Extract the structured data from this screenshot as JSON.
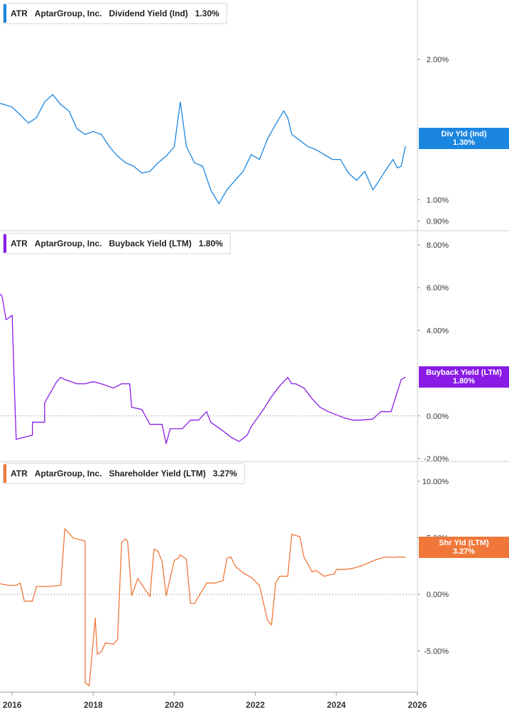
{
  "chart_data": [
    {
      "type": "line",
      "ticker": "ATR",
      "company": "AptarGroup, Inc.",
      "metric": "Dividend Yield (Ind)",
      "current": "1.30%",
      "tag_line1": "Div Yld (Ind)",
      "tag_line2": "1.30%",
      "color": "#1a86e0",
      "scale": "log",
      "ylim": [
        0.87,
        2.5
      ],
      "yticks": [
        "2.00%",
        "1.00%",
        "0.90%"
      ],
      "ytick_values": [
        2.0,
        1.0,
        0.9
      ],
      "x": [
        2015.6,
        2015.8,
        2016.0,
        2016.2,
        2016.4,
        2016.6,
        2016.8,
        2017.0,
        2017.2,
        2017.4,
        2017.6,
        2017.8,
        2018.0,
        2018.2,
        2018.4,
        2018.6,
        2018.8,
        2019.0,
        2019.2,
        2019.4,
        2019.6,
        2019.8,
        2020.0,
        2020.15,
        2020.3,
        2020.5,
        2020.7,
        2020.9,
        2021.1,
        2021.3,
        2021.5,
        2021.7,
        2021.9,
        2022.1,
        2022.3,
        2022.5,
        2022.7,
        2022.8,
        2022.9,
        2023.1,
        2023.3,
        2023.5,
        2023.7,
        2023.9,
        2024.1,
        2024.3,
        2024.5,
        2024.7,
        2024.9,
        2025.0,
        2025.2,
        2025.4,
        2025.5,
        2025.6,
        2025.7
      ],
      "y": [
        1.62,
        1.6,
        1.58,
        1.52,
        1.46,
        1.5,
        1.62,
        1.68,
        1.6,
        1.55,
        1.42,
        1.38,
        1.4,
        1.38,
        1.3,
        1.24,
        1.2,
        1.18,
        1.14,
        1.15,
        1.2,
        1.24,
        1.3,
        1.62,
        1.3,
        1.2,
        1.18,
        1.05,
        0.98,
        1.05,
        1.1,
        1.15,
        1.25,
        1.22,
        1.35,
        1.45,
        1.55,
        1.5,
        1.38,
        1.34,
        1.3,
        1.28,
        1.25,
        1.22,
        1.22,
        1.14,
        1.1,
        1.15,
        1.05,
        1.08,
        1.15,
        1.22,
        1.17,
        1.18,
        1.3
      ],
      "last_value": 1.3
    },
    {
      "type": "line",
      "ticker": "ATR",
      "company": "AptarGroup, Inc.",
      "metric": "Buyback Yield (LTM)",
      "current": "1.80%",
      "tag_line1": "Buyback Yield (LTM)",
      "tag_line2": "1.80%",
      "color": "#8a1be6",
      "scale": "linear",
      "ylim": [
        -2.0,
        8.0
      ],
      "yticks": [
        "8.00%",
        "6.00%",
        "4.00%",
        "0.00%",
        "-2.00%"
      ],
      "ytick_values": [
        8,
        6,
        4,
        0,
        -2
      ],
      "zero_line": true,
      "x": [
        2015.6,
        2015.75,
        2015.85,
        2016.0,
        2016.06,
        2016.1,
        2016.5,
        2016.5,
        2016.8,
        2016.8,
        2017.1,
        2017.2,
        2017.3,
        2017.6,
        2017.8,
        2018.0,
        2018.2,
        2018.5,
        2018.7,
        2018.8,
        2018.9,
        2018.95,
        2019.2,
        2019.4,
        2019.5,
        2019.7,
        2019.8,
        2019.9,
        2020.2,
        2020.4,
        2020.6,
        2020.8,
        2020.9,
        2021.2,
        2021.4,
        2021.6,
        2021.8,
        2021.9,
        2022.2,
        2022.4,
        2022.6,
        2022.8,
        2022.9,
        2023.0,
        2023.2,
        2023.4,
        2023.6,
        2023.8,
        2024.2,
        2024.4,
        2024.6,
        2024.9,
        2025.1,
        2025.2,
        2025.35,
        2025.5,
        2025.6,
        2025.7
      ],
      "y": [
        5.9,
        5.6,
        4.5,
        4.7,
        1.0,
        -1.1,
        -0.9,
        -0.3,
        -0.3,
        0.6,
        1.6,
        1.8,
        1.7,
        1.5,
        1.5,
        1.6,
        1.5,
        1.3,
        1.5,
        1.5,
        1.5,
        0.4,
        0.3,
        -0.4,
        -0.4,
        -0.4,
        -1.3,
        -0.6,
        -0.6,
        -0.2,
        -0.2,
        0.2,
        -0.3,
        -0.7,
        -1.0,
        -1.2,
        -0.9,
        -0.5,
        0.3,
        0.9,
        1.4,
        1.8,
        1.5,
        1.5,
        1.3,
        0.8,
        0.4,
        0.2,
        -0.1,
        -0.2,
        -0.2,
        -0.15,
        0.2,
        0.2,
        0.2,
        1.1,
        1.7,
        1.8
      ],
      "last_value": 1.8
    },
    {
      "type": "line",
      "ticker": "ATR",
      "company": "AptarGroup, Inc.",
      "metric": "Shareholder Yield (LTM)",
      "current": "3.27%",
      "tag_line1": "Shr Yld (LTM)",
      "tag_line2": "3.27%",
      "color": "#f0773a",
      "scale": "linear",
      "ylim": [
        -8.4,
        10.5
      ],
      "yticks": [
        "10.00%",
        "5.00%",
        "0.00%",
        "-5.00%"
      ],
      "ytick_values": [
        10,
        5,
        0,
        -5
      ],
      "zero_line": true,
      "x": [
        2015.6,
        2015.9,
        2016.1,
        2016.2,
        2016.3,
        2016.5,
        2016.6,
        2016.9,
        2017.2,
        2017.3,
        2017.4,
        2017.5,
        2017.8,
        2017.8,
        2017.9,
        2018.05,
        2018.1,
        2018.2,
        2018.3,
        2018.5,
        2018.6,
        2018.7,
        2018.8,
        2018.85,
        2018.95,
        2019.1,
        2019.4,
        2019.5,
        2019.6,
        2019.7,
        2019.8,
        2020.0,
        2020.1,
        2020.15,
        2020.3,
        2020.4,
        2020.5,
        2020.8,
        2021.0,
        2021.2,
        2021.3,
        2021.4,
        2021.5,
        2021.7,
        2021.9,
        2022.1,
        2022.3,
        2022.4,
        2022.5,
        2022.6,
        2022.8,
        2022.9,
        2023.1,
        2023.2,
        2023.4,
        2023.5,
        2023.7,
        2023.8,
        2023.95,
        2024.0,
        2024.2,
        2024.4,
        2024.6,
        2024.8,
        2025.0,
        2025.2,
        2025.4,
        2025.5,
        2025.6,
        2025.7
      ],
      "y": [
        1.0,
        0.8,
        0.8,
        1.0,
        -0.6,
        -0.6,
        0.7,
        0.7,
        0.8,
        5.8,
        5.4,
        5.0,
        4.7,
        -7.8,
        -8.1,
        -2.1,
        -5.3,
        -5.1,
        -4.3,
        -4.4,
        -4.0,
        4.6,
        4.9,
        4.7,
        -0.1,
        1.4,
        -0.2,
        4.0,
        3.8,
        2.9,
        -0.1,
        3.0,
        3.2,
        3.5,
        3.1,
        -0.8,
        -0.8,
        1.0,
        1.0,
        1.2,
        3.2,
        3.3,
        2.5,
        1.9,
        1.5,
        0.8,
        -2.3,
        -2.7,
        1.0,
        1.6,
        1.6,
        5.3,
        5.1,
        3.3,
        2.0,
        2.1,
        1.6,
        1.7,
        1.8,
        2.2,
        2.2,
        2.3,
        2.5,
        2.8,
        3.1,
        3.3,
        3.27,
        3.3,
        3.3,
        3.27
      ],
      "last_value": 3.27
    }
  ],
  "x_axis": {
    "ticks": [
      "2016",
      "2018",
      "2020",
      "2022",
      "2024",
      "2026"
    ],
    "tick_values": [
      2016,
      2018,
      2020,
      2022,
      2024,
      2026
    ],
    "range": [
      2015.7,
      2026
    ]
  }
}
